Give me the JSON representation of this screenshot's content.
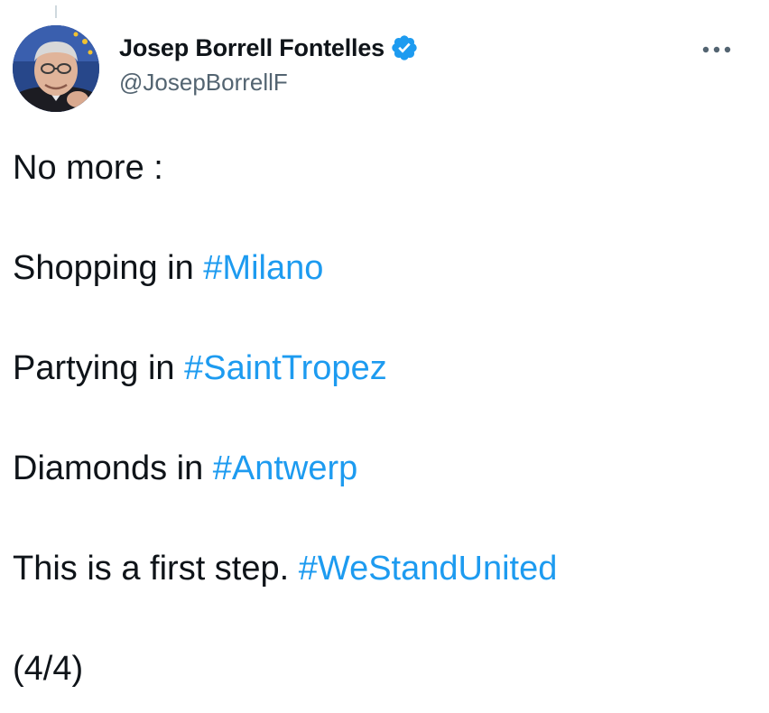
{
  "author": {
    "display_name": "Josep Borrell Fontelles",
    "handle": "@JosepBorrellF",
    "verified": true,
    "avatar_icon": "profile-photo"
  },
  "icons": {
    "verified": "verified-badge-icon",
    "more": "more-options-icon"
  },
  "colors": {
    "hashtag": "#1d9bf0",
    "text": "#0f1419",
    "secondary": "#536471",
    "verified_badge": "#1d9bf0"
  },
  "tweet": {
    "line1": "No more :",
    "line2_text": "Shopping in ",
    "line2_hashtag": "#Milano",
    "line3_text": "Partying in ",
    "line3_hashtag": "#SaintTropez",
    "line4_text": "Diamonds in ",
    "line4_hashtag": "#Antwerp",
    "line5_text": "This is a first step. ",
    "line5_hashtag": "#WeStandUnited",
    "line6": "(4/4)"
  }
}
